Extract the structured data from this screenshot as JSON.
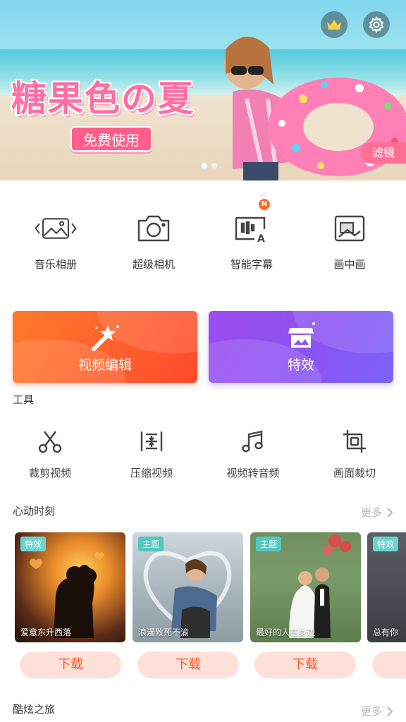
{
  "banner": {
    "title": "糖果色の夏",
    "cta": "免费使用",
    "tag": "滤镜",
    "dots": 2
  },
  "top_buttons": {
    "vip_icon": "crown-icon",
    "settings_icon": "gear-icon"
  },
  "quick": [
    {
      "label": "音乐相册",
      "icon": "music-album-icon"
    },
    {
      "label": "超级相机",
      "icon": "camera-icon"
    },
    {
      "label": "智能字幕",
      "icon": "subtitle-icon",
      "badge": "N"
    },
    {
      "label": "画中画",
      "icon": "picture-in-picture-icon"
    }
  ],
  "cards": {
    "edit": {
      "label": "视频编辑",
      "icon": "magic-wand-icon"
    },
    "effects": {
      "label": "特效",
      "icon": "store-icon"
    }
  },
  "tools": {
    "title": "工具",
    "items": [
      {
        "label": "裁剪视频",
        "icon": "scissors-icon"
      },
      {
        "label": "压缩视频",
        "icon": "compress-icon"
      },
      {
        "label": "视频转音频",
        "icon": "music-note-icon"
      },
      {
        "label": "画面裁切",
        "icon": "crop-icon"
      }
    ]
  },
  "heart": {
    "title": "心动时刻",
    "more": "更多",
    "items": [
      {
        "tag": "特效",
        "caption": "爱意东升西落",
        "download": "下载"
      },
      {
        "tag": "主题",
        "caption": "浪漫致死不渝",
        "download": "下载"
      },
      {
        "tag": "主题",
        "caption": "最好的人在身边",
        "download": "下载"
      },
      {
        "tag": "特效",
        "caption": "总有你",
        "download": ""
      }
    ]
  },
  "cool": {
    "title": "酷炫之旅",
    "more": "更多"
  },
  "colors": {
    "accent": "#ff5a2c",
    "purple": "#8a55f2",
    "tag": "#53c7c1"
  }
}
